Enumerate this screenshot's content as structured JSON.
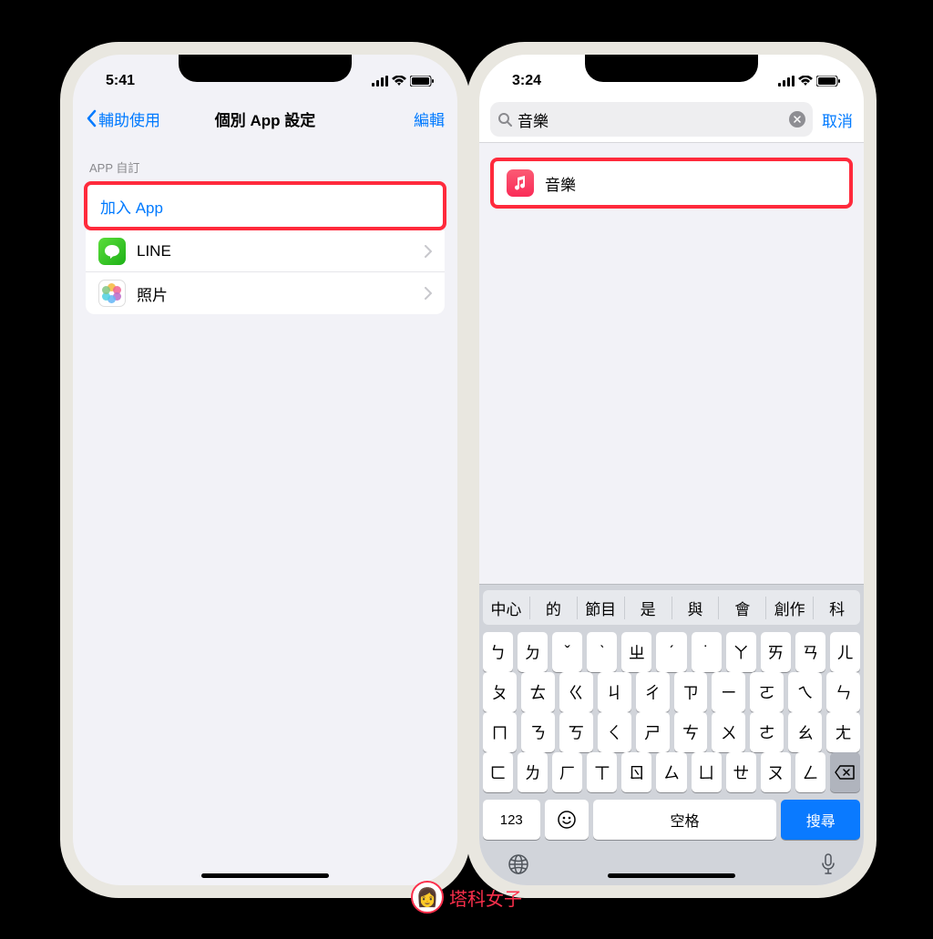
{
  "colors": {
    "accent": "#007aff",
    "highlight": "#ff2a3c",
    "music_icon": "#fa2b57"
  },
  "left": {
    "status_time": "5:41",
    "nav_back": "輔助使用",
    "nav_title": "個別 App 設定",
    "nav_edit": "編輯",
    "section_header": "APP 自訂",
    "add_app": "加入 App",
    "rows": [
      {
        "icon": "line-icon",
        "label": "LINE"
      },
      {
        "icon": "photos-icon",
        "label": "照片"
      }
    ]
  },
  "right": {
    "status_time": "3:24",
    "search_value": "音樂",
    "cancel": "取消",
    "result_label": "音樂",
    "suggestions": [
      "中心",
      "的",
      "節目",
      "是",
      "與",
      "會",
      "創作",
      "科"
    ],
    "key_rows": [
      [
        "ㄅ",
        "ㄉ",
        "ˇ",
        "ˋ",
        "ㄓ",
        "ˊ",
        "˙",
        "ㄚ",
        "ㄞ",
        "ㄢ",
        "ㄦ"
      ],
      [
        "ㄆ",
        "ㄊ",
        "ㄍ",
        "ㄐ",
        "ㄔ",
        "ㄗ",
        "ㄧ",
        "ㄛ",
        "ㄟ",
        "ㄣ"
      ],
      [
        "ㄇ",
        "ㄋ",
        "ㄎ",
        "ㄑ",
        "ㄕ",
        "ㄘ",
        "ㄨ",
        "ㄜ",
        "ㄠ",
        "ㄤ"
      ],
      [
        "ㄈ",
        "ㄌ",
        "ㄏ",
        "ㄒ",
        "ㄖ",
        "ㄙ",
        "ㄩ",
        "ㄝ",
        "ㄡ",
        "ㄥ"
      ]
    ],
    "num_key": "123",
    "space_key": "空格",
    "search_key": "搜尋"
  },
  "watermark": "塔科女子"
}
